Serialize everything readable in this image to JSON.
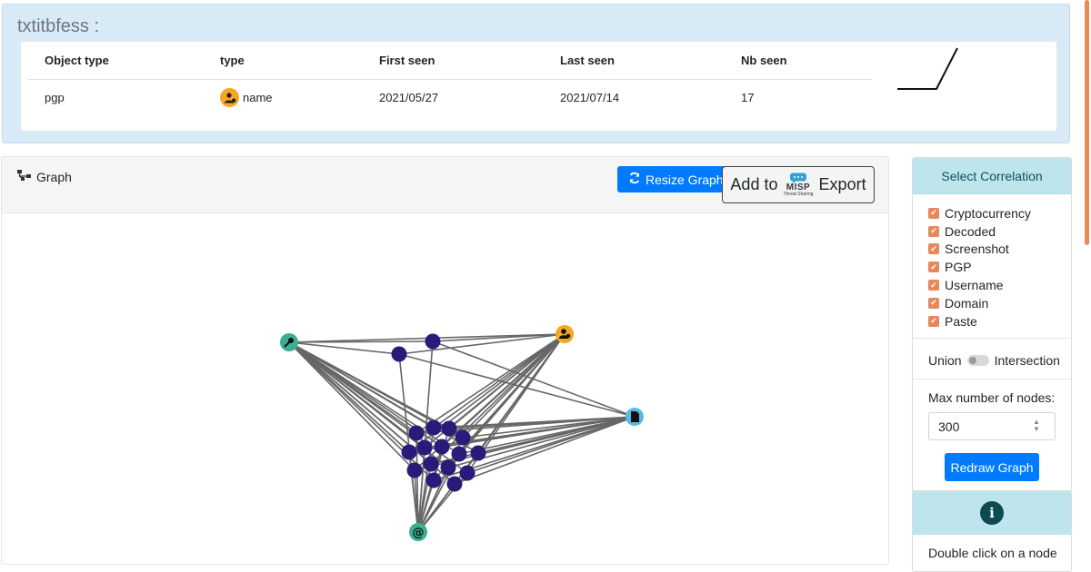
{
  "object": {
    "title": "txtitbfess :",
    "columns": [
      "Object type",
      "type",
      "First seen",
      "Last seen",
      "Nb seen"
    ],
    "row": {
      "object_type": "pgp",
      "type_icon": "user-icon",
      "type": "name",
      "first_seen": "2021/05/27",
      "last_seen": "2021/07/14",
      "nb_seen": "17"
    }
  },
  "graph": {
    "label": "Graph",
    "label_icon": "network-icon",
    "resize_label": "Resize Graph",
    "resize_icon": "refresh-icon",
    "export_prefix": "Add to",
    "export_logo_text": "MISP",
    "export_logo_sub": "Threat Sharing",
    "export_suffix": "Export",
    "node_icons": {
      "key": "key-icon",
      "user": "user-icon",
      "file": "file-icon",
      "at": "at-icon"
    }
  },
  "correlation": {
    "header": "Select Correlation",
    "options": [
      "Cryptocurrency",
      "Decoded",
      "Screenshot",
      "PGP",
      "Username",
      "Domain",
      "Paste"
    ],
    "union_label": "Union",
    "intersection_label": "Intersection",
    "max_nodes_label": "Max number of nodes:",
    "max_nodes_value": "300",
    "redraw_label": "Redraw Graph"
  },
  "info": {
    "icon": "info-icon",
    "icon_glyph": "i",
    "text": "Double click on a node"
  },
  "colors": {
    "node": "#2a1a7a",
    "node_teal": "#3aaf94",
    "node_orange": "#f5a623",
    "node_blue": "#5bb8e0",
    "edge": "#666666",
    "accent": "#007bff",
    "checkbox": "#e8885a"
  }
}
